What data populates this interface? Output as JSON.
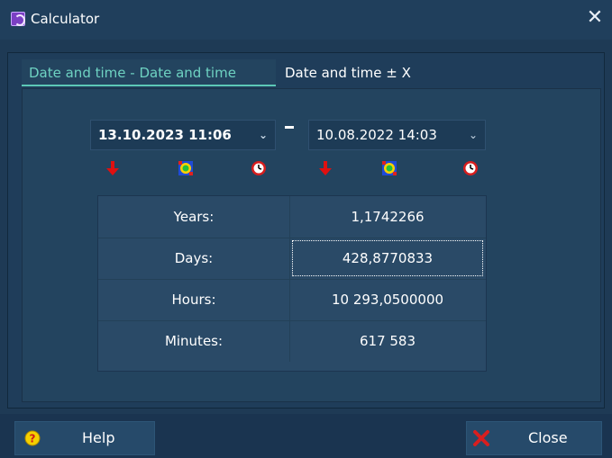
{
  "window": {
    "title": "Calculator",
    "close_glyph": "✕"
  },
  "tabs": [
    {
      "label": "Date and time - Date and time",
      "active": true
    },
    {
      "label": "Date and time ± X",
      "active": false
    }
  ],
  "dates": {
    "start": {
      "value": "13.10.2023 11:06"
    },
    "separator": "-",
    "end": {
      "value": "10.08.2022 14:03"
    }
  },
  "icons": {
    "set_start_group": [
      "down-arrow-icon",
      "calendar-gear-icon",
      "clock-icon"
    ],
    "set_end_group": [
      "down-arrow-icon",
      "calendar-gear-icon",
      "clock-icon"
    ]
  },
  "results": [
    {
      "label": "Years:",
      "value": "1,1742266"
    },
    {
      "label": "Days:",
      "value": "428,8770833"
    },
    {
      "label": "Hours:",
      "value": "10 293,0500000"
    },
    {
      "label": "Minutes:",
      "value": "617 583"
    }
  ],
  "buttons": {
    "help": "Help",
    "close": "Close"
  },
  "colors": {
    "background": "#1e3a55",
    "active_tab_text": "#6ed2c2",
    "arrow_red": "#e01010",
    "close_icon_red": "#d81e1e",
    "help_icon_yellow": "#f5d000"
  }
}
